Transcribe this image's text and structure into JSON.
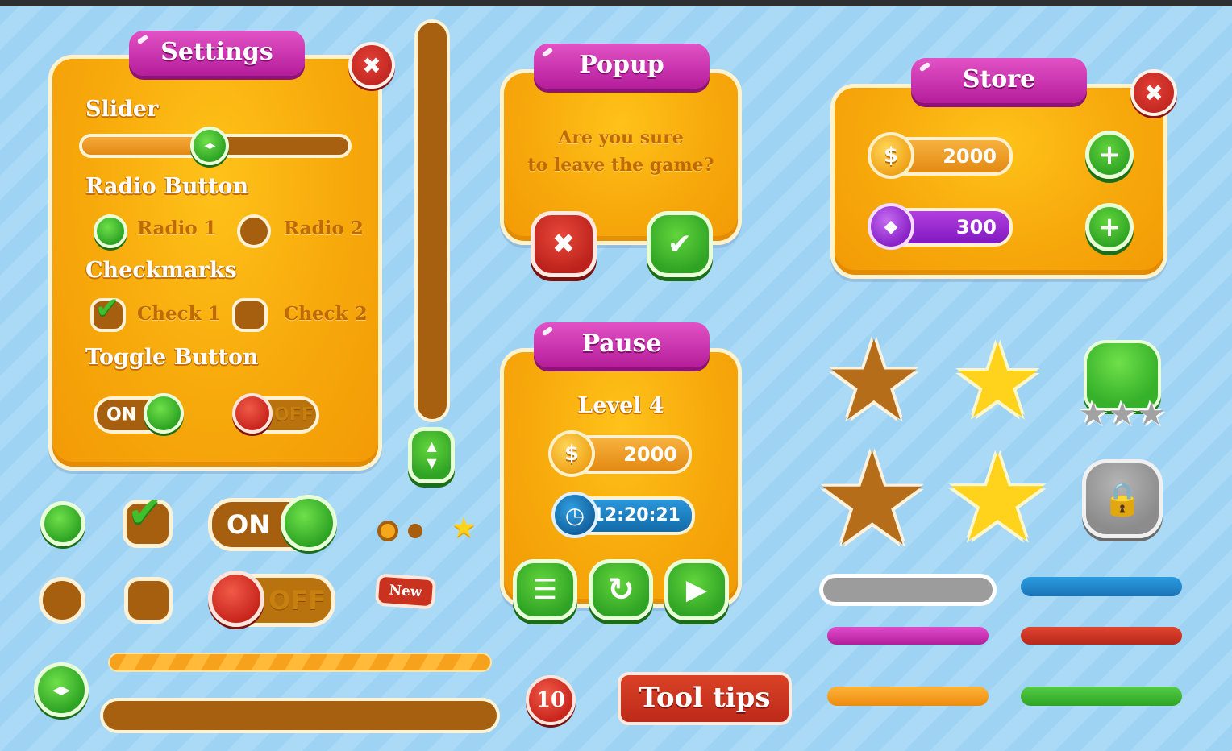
{
  "settings": {
    "title": "Settings",
    "close_glyph": "✖",
    "slider_label": "Slider",
    "slider_value": 0.48,
    "slider_knob_glyph": "◂▸",
    "radio_label": "Radio Button",
    "radio_1": "Radio 1",
    "radio_2": "Radio 2",
    "checkmarks_label": "Checkmarks",
    "check_1": "Check 1",
    "check_2": "Check 2",
    "toggle_label": "Toggle Button",
    "toggle_on": "ON",
    "toggle_off": "OFF"
  },
  "popup": {
    "title": "Popup",
    "message_line1": "Are you sure",
    "message_line2": "to leave the game?",
    "cancel_glyph": "✖",
    "confirm_glyph": "✔"
  },
  "store": {
    "title": "Store",
    "close_glyph": "✖",
    "coin_symbol": "$",
    "coins": "2000",
    "gem_symbol": "◆",
    "gems": "300",
    "plus_glyph": "+"
  },
  "pause": {
    "title": "Pause",
    "level": "Level 4",
    "coin_symbol": "$",
    "coins": "2000",
    "clock_glyph": "◷",
    "time": "12:20:21",
    "menu_glyph": "☰",
    "restart_glyph": "↻",
    "play_glyph": "▶"
  },
  "widgets": {
    "toggle_on": "ON",
    "toggle_off": "OFF",
    "badge_new": "New",
    "counter": "10",
    "tooltip": "Tool tips",
    "scroll_glyph": "▲▼",
    "arrows_glyph": "◂▸",
    "check_glyph": "✔",
    "lock_glyph": "🔒",
    "star_glyph": "★"
  },
  "colors": {
    "panel": "#f7a90b",
    "ribbon": "#c526a8",
    "green": "#2ea424",
    "red": "#c9261d",
    "brown": "#a65f0e",
    "blue_bar": "#1f82c8",
    "magenta_bar": "#c72bb0",
    "orange_bar": "#f39a12",
    "green_bar": "#37b134",
    "red_bar": "#c8321e",
    "gray_bar": "#9a9a9a"
  }
}
